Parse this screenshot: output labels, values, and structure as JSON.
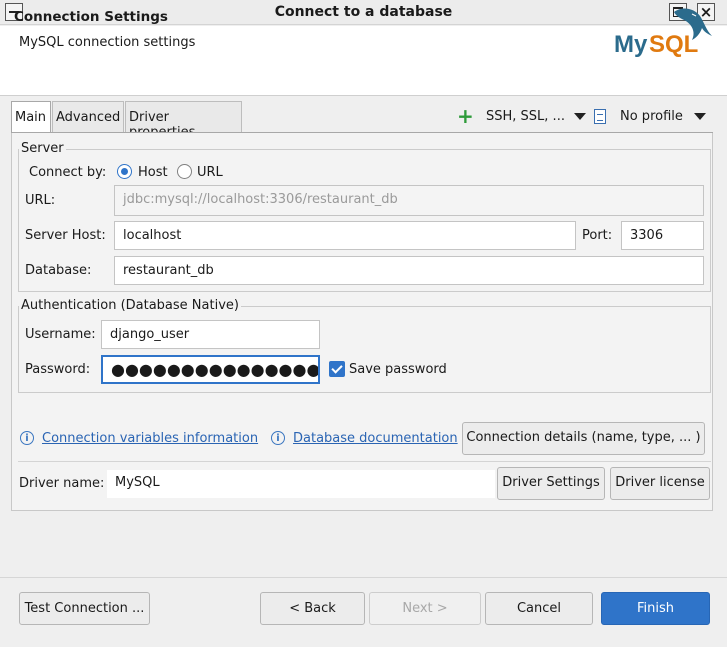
{
  "window": {
    "title": "Connect to a database"
  },
  "header": {
    "title": "Connection Settings",
    "subtitle": "MySQL connection settings",
    "logo_text": "MySQL",
    "logo_color_my": "#2b6b8c",
    "logo_color_sql": "#e07a10"
  },
  "tabs": [
    {
      "label": "Main",
      "active": true
    },
    {
      "label": "Advanced",
      "active": false
    },
    {
      "label": "Driver properties",
      "active": false
    }
  ],
  "toolbar": {
    "ssh_label": "SSH, SSL, ...",
    "profile_label": "No profile"
  },
  "server": {
    "legend": "Server",
    "connect_by_label": "Connect by:",
    "host_option": "Host",
    "url_option": "URL",
    "selected": "Host",
    "url_label": "URL:",
    "url_value": "jdbc:mysql://localhost:3306/restaurant_db",
    "host_label": "Server Host:",
    "host_value": "localhost",
    "port_label": "Port:",
    "port_value": "3306",
    "database_label": "Database:",
    "database_value": "restaurant_db"
  },
  "auth": {
    "legend": "Authentication (Database Native)",
    "username_label": "Username:",
    "username_value": "django_user",
    "password_label": "Password:",
    "password_masked": "●●●●●●●●●●●●●●●",
    "save_password_label": "Save password",
    "save_password_checked": true
  },
  "links": {
    "conn_vars": "Connection variables information",
    "db_docs": "Database documentation"
  },
  "buttons": {
    "conn_details": "Connection details (name, type, ... )",
    "driver_settings": "Driver Settings",
    "driver_license": "Driver license",
    "test": "Test Connection ...",
    "back": "< Back",
    "next": "Next >",
    "cancel": "Cancel",
    "finish": "Finish"
  },
  "driver": {
    "label": "Driver name:",
    "value": "MySQL"
  },
  "colors": {
    "accent": "#2f74c9",
    "link": "#2a64b3",
    "plus": "#2e9b3a"
  }
}
